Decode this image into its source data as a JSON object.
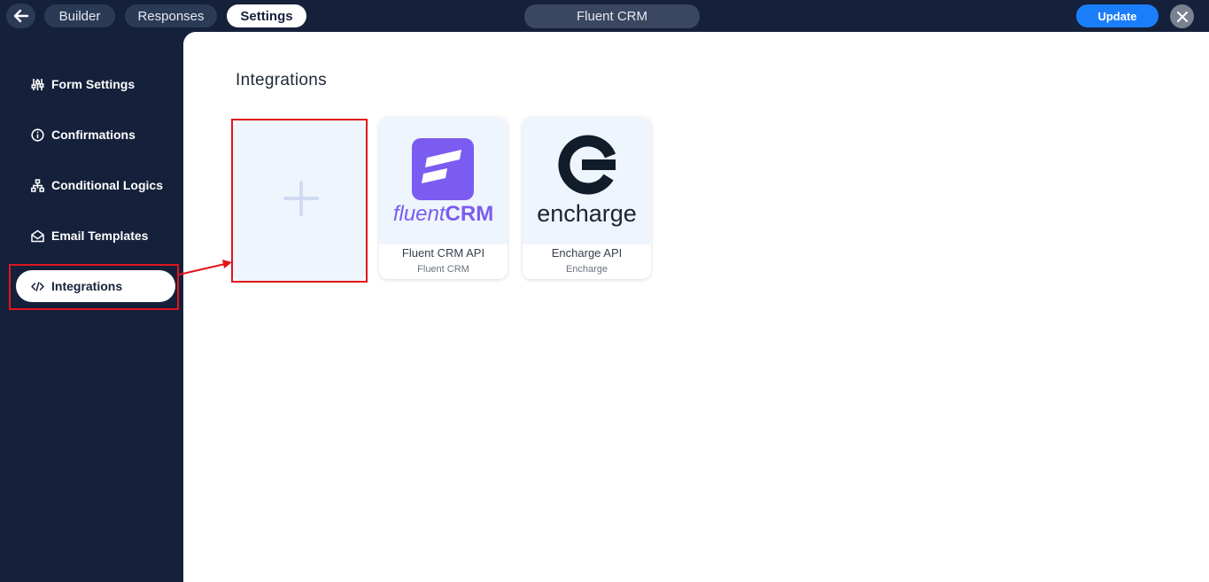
{
  "topbar": {
    "tabs": [
      {
        "label": "Builder"
      },
      {
        "label": "Responses"
      },
      {
        "label": "Settings"
      }
    ],
    "form_title": "Fluent CRM",
    "update_label": "Update"
  },
  "sidebar": {
    "items": [
      {
        "label": "Form Settings",
        "icon": "sliders-icon"
      },
      {
        "label": "Confirmations",
        "icon": "info-icon"
      },
      {
        "label": "Conditional Logics",
        "icon": "sitemap-icon"
      },
      {
        "label": "Email Templates",
        "icon": "envelope-open-icon"
      },
      {
        "label": "Integrations",
        "icon": "code-icon",
        "active": true
      }
    ]
  },
  "main": {
    "title": "Integrations",
    "integrations": [
      {
        "logo_word_a": "fluent",
        "logo_word_b": "CRM",
        "name": "Fluent CRM API",
        "sub": "Fluent CRM"
      },
      {
        "logo_word": "encharge",
        "name": "Encharge API",
        "sub": "Encharge"
      }
    ]
  },
  "colors": {
    "navy": "#15213b",
    "accent": "#1a7efb",
    "fluent_purple": "#7b5cf0",
    "highlight_red": "#e0151b"
  }
}
